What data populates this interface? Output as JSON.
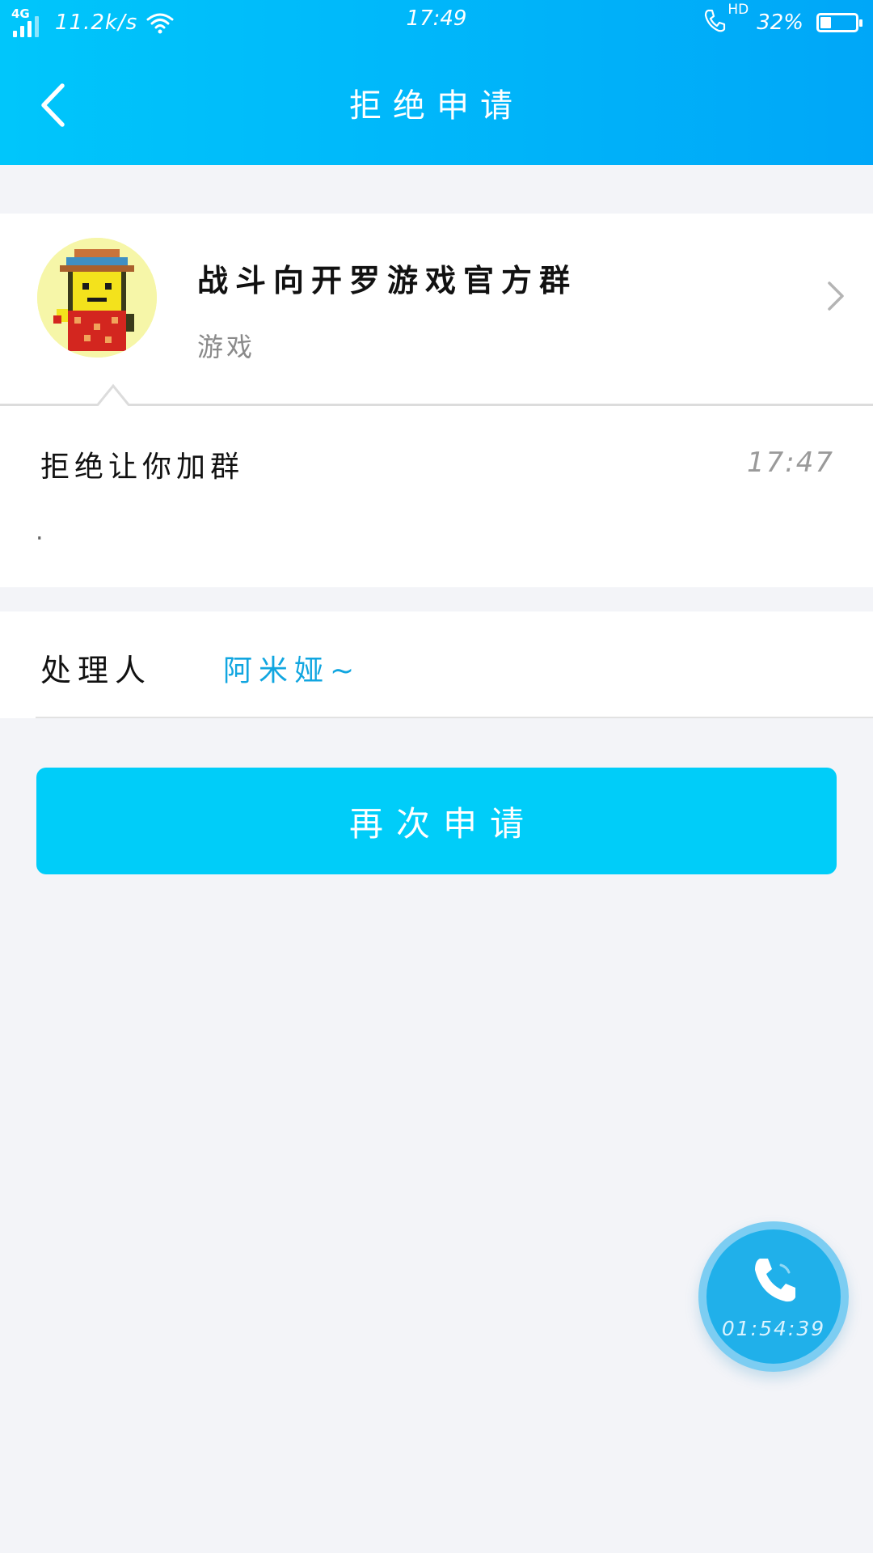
{
  "status_bar": {
    "network": "4G",
    "speed": "11.2k/s",
    "time": "17:49",
    "hd": "HD",
    "battery": "32%",
    "battery_level": 0.32
  },
  "nav": {
    "title": "拒绝申请"
  },
  "group": {
    "name": "战斗向开罗游戏官方群",
    "category": "游戏"
  },
  "message": {
    "title": "拒绝让你加群",
    "time": "17:47",
    "body": "."
  },
  "handler": {
    "label": "处理人",
    "name": "阿米娅~"
  },
  "actions": {
    "reapply_label": "再次申请"
  },
  "call": {
    "timer": "01:54:39"
  },
  "colors": {
    "header_start": "#00c6fb",
    "header_end": "#00a7f8",
    "accent": "#00cdf9",
    "link": "#11a6e0",
    "background": "#f3f4f8"
  }
}
